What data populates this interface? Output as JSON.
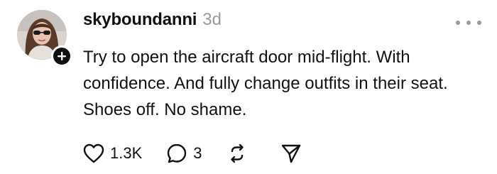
{
  "post": {
    "username": "skyboundanni",
    "timestamp": "3d",
    "text": "Try to open the aircraft door mid-flight. With confidence. And fully change outfits in their seat. Shoes off. No shame.",
    "avatar_icon": "profile-photo",
    "follow_icon": "plus-icon",
    "more_icon": "more-horizontal-icon"
  },
  "actions": {
    "likes": "1.3K",
    "replies": "3",
    "like_icon": "heart-icon",
    "reply_icon": "comment-icon",
    "repost_icon": "repost-icon",
    "share_icon": "send-icon"
  },
  "colors": {
    "text": "#111111",
    "muted": "#9a9a9a",
    "badge": "#0f0f0f",
    "background": "#ffffff"
  }
}
